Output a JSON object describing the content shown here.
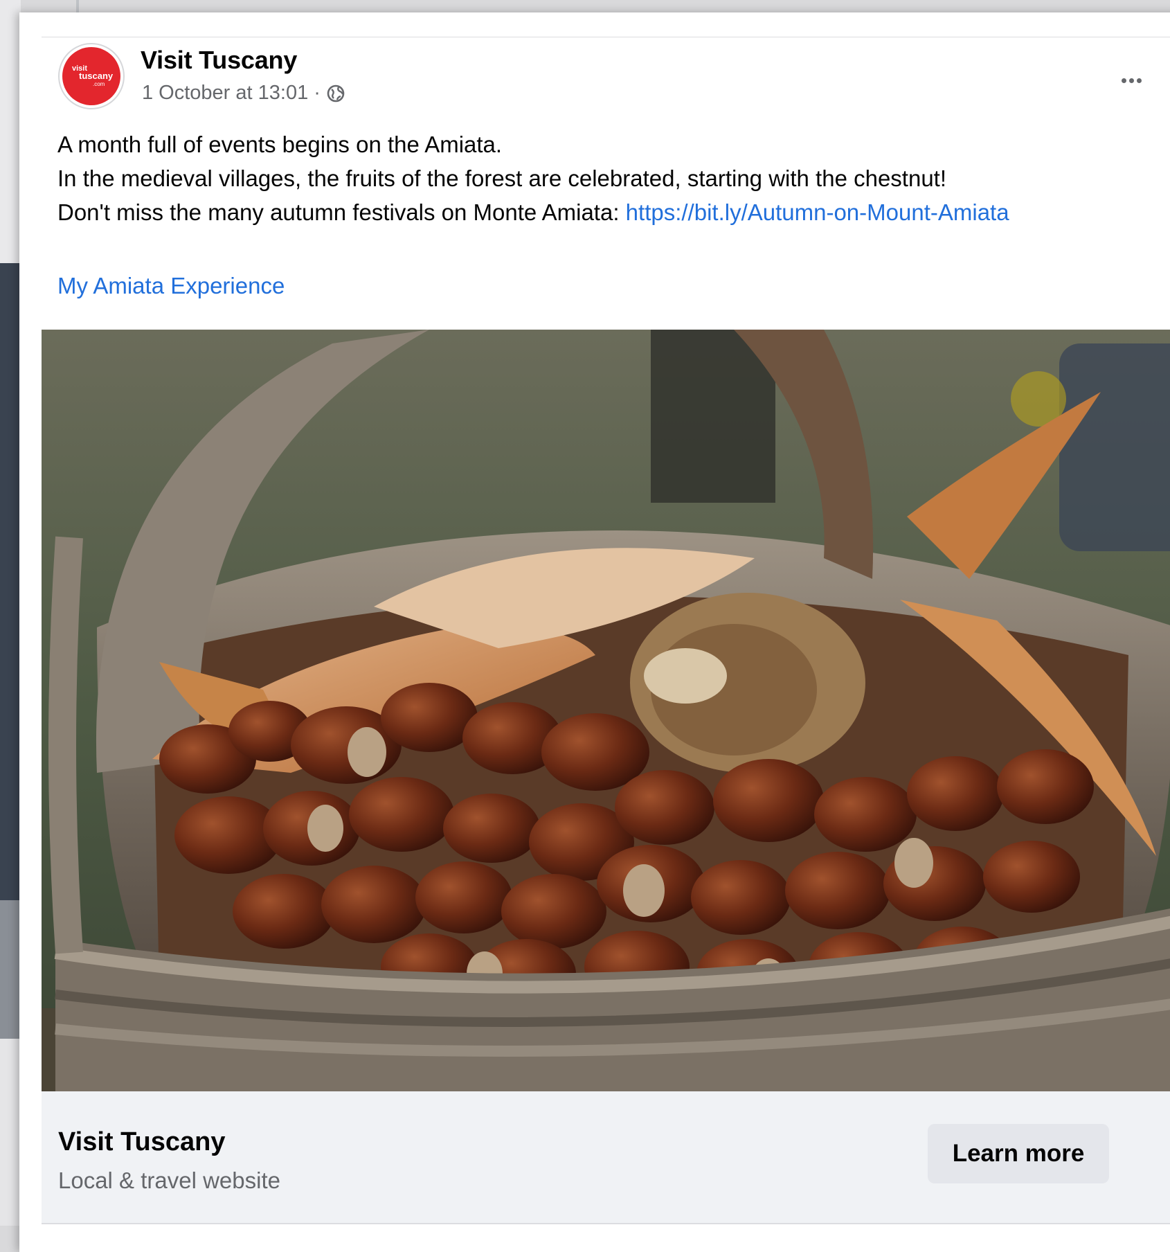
{
  "post": {
    "page_name": "Visit Tuscany",
    "avatar_logo_text": [
      "visit",
      "tuscany",
      ".com"
    ],
    "timestamp": "1 October at 13:01",
    "separator": "·",
    "audience_icon": "globe-icon",
    "more_icon": "more-options-icon",
    "text_line_1": "A month full of events begins on the Amiata.",
    "text_line_2": "In the medieval villages, the fruits of the forest are celebrated, starting with the chestnut!",
    "text_line_3_prefix": "Don't miss the many autumn festivals on Monte Amiata: ",
    "link": "https://bit.ly/Autumn-on-Mount-Amiata",
    "hashtag": "My Amiata Experience"
  },
  "cta": {
    "title": "Visit Tuscany",
    "subtitle": "Local & travel website",
    "button_label": "Learn more"
  },
  "colors": {
    "link": "#216fdb",
    "brand_red": "#e3262d",
    "secondary_text": "#65676b",
    "cta_background": "#f0f2f5",
    "button_background": "#e4e6eb"
  }
}
